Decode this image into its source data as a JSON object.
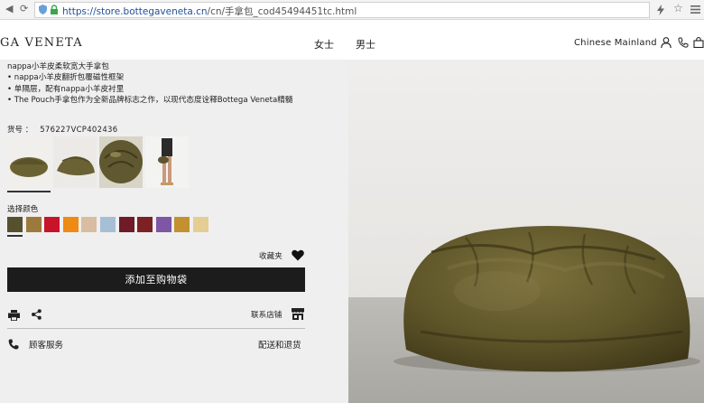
{
  "browser": {
    "url_host": "https://store.bottegaveneta.cn",
    "url_path": "/cn/手拿包_cod45494451tc.html"
  },
  "header": {
    "logo": "GA VENETA",
    "nav": [
      "女士",
      "男士"
    ],
    "region": "Chinese Mainland"
  },
  "product": {
    "features": [
      "nappa小羊皮柔软宽大手拿包",
      "• nappa小羊皮翻折包覆磁性框架",
      "• 单隔层，配有nappa小羊皮衬里",
      "• The Pouch手拿包作为全新品牌标志之作，以现代态度诠释Bottega Veneta精髓"
    ],
    "sku_label": "货号 ：",
    "sku_value": "576227VCP402436",
    "color_label": "选择颜色",
    "swatches": [
      "#57502f",
      "#9c7a3e",
      "#c8132b",
      "#ef8a14",
      "#d8bda0",
      "#a6bfd4",
      "#6f1b28",
      "#7d2222",
      "#7e56a6",
      "#c39130",
      "#e5ce93"
    ],
    "favorite_label": "收藏夹",
    "add_to_bag": "添加至购物袋",
    "contact_store": "联系店铺",
    "customer_service": "顾客服务",
    "shipping_returns": "配送和退货"
  }
}
